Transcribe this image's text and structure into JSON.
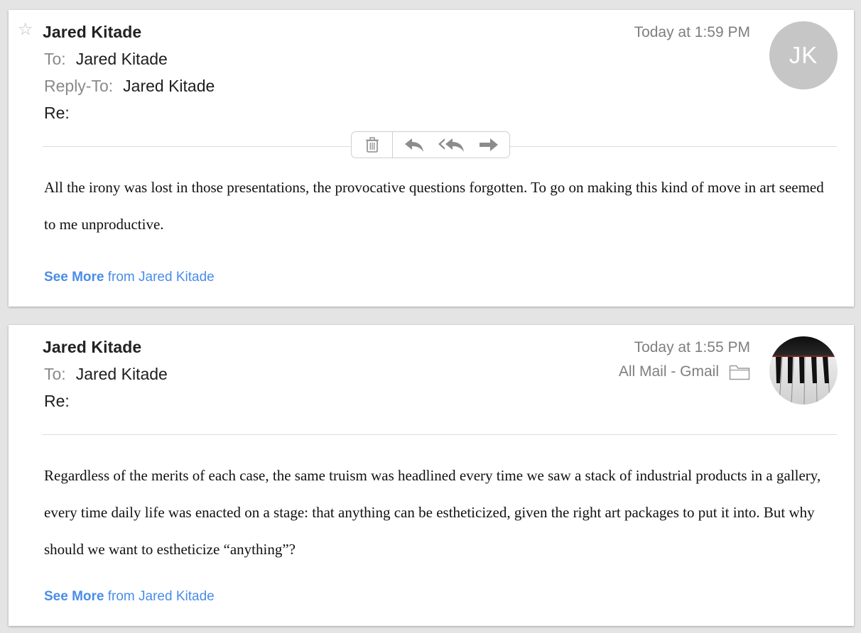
{
  "messages": [
    {
      "sender": "Jared Kitade",
      "date": "Today at 1:59 PM",
      "to_label": "To:",
      "to": "Jared Kitade",
      "reply_to_label": "Reply-To:",
      "reply_to": "Jared Kitade",
      "re_label": "Re:",
      "avatar_initials": "JK",
      "body": "All the irony was lost in those presentations, the provocative questions forgotten. To go on making this kind of move in art seemed to me unproductive.",
      "see_more_bold": "See More",
      "see_more_rest": " from Jared Kitade",
      "icons": [
        "star-icon",
        "trash-icon",
        "reply-icon",
        "reply-all-icon",
        "forward-icon"
      ]
    },
    {
      "sender": "Jared Kitade",
      "date": "Today at 1:55 PM",
      "mailbox": "All Mail - Gmail",
      "to_label": "To:",
      "to": "Jared Kitade",
      "re_label": "Re:",
      "body": "Regardless of the merits of each case, the same truism was headlined every time we saw a stack of industrial products in a gallery, every time daily life was enacted on a stage: that anything can be estheticized, given the right art packages to put it into. But why should we want to estheticize “anything”?",
      "see_more_bold": "See More",
      "see_more_rest": " from Jared Kitade",
      "icons": [
        "folder-icon",
        "piano-keys-avatar"
      ]
    }
  ],
  "colors": {
    "background": "#e4e4e4",
    "card": "#ffffff",
    "link": "#4a8ce8",
    "avatar_gray": "#c6c6c6",
    "muted_text": "#7f7f7f"
  }
}
